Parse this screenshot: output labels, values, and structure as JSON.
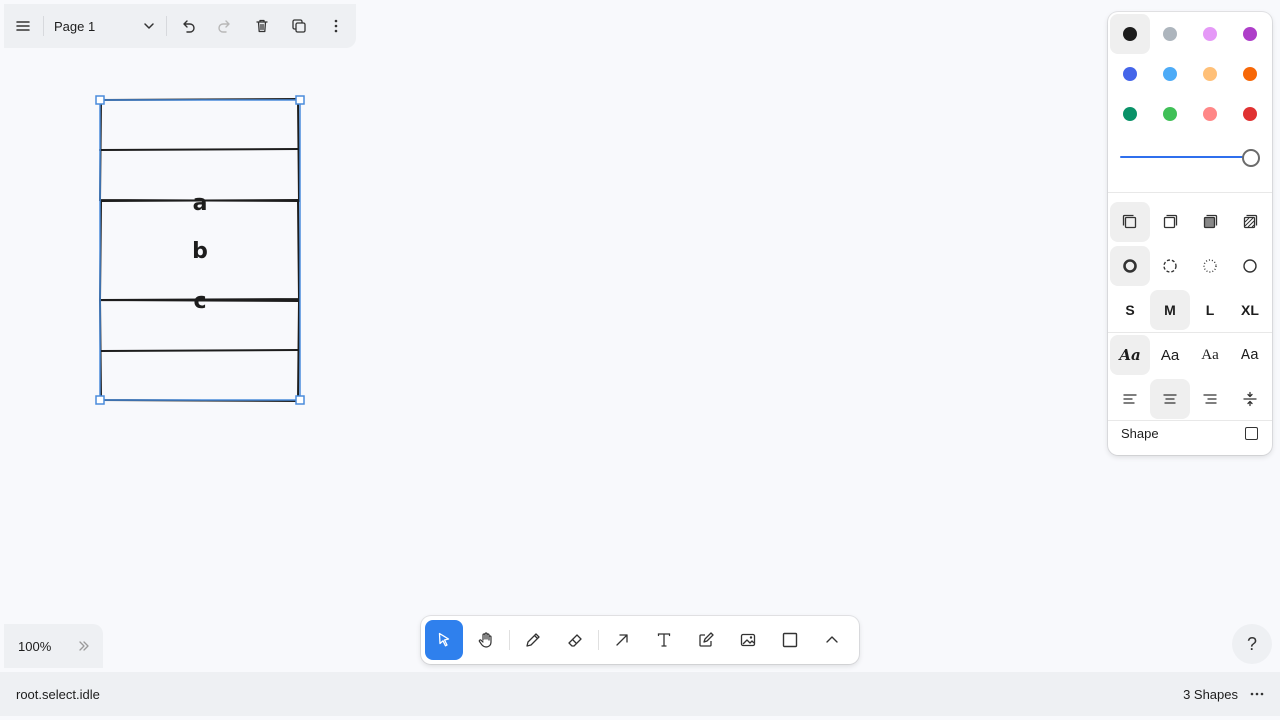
{
  "menubar": {
    "page_name": "Page 1"
  },
  "canvas": {
    "labels": [
      "a",
      "b",
      "c"
    ]
  },
  "style_panel": {
    "colors": [
      "#1d1d1d",
      "#adb5bd",
      "#e599f7",
      "#ae3ec9",
      "#4465e9",
      "#4dabf7",
      "#ffc078",
      "#f76707",
      "#099268",
      "#40c057",
      "#ff8787",
      "#e03131"
    ],
    "selected_color_index": 0,
    "opacity": 1.0,
    "sizes": [
      "S",
      "M",
      "L",
      "XL"
    ],
    "selected_size": "M",
    "font_sample": "Aa",
    "shape_label": "Shape"
  },
  "toolbar": {
    "tools": [
      "select-tool",
      "hand-tool",
      "draw-tool",
      "eraser-tool",
      "arrow-tool",
      "text-tool",
      "note-tool",
      "image-tool",
      "rectangle-tool",
      "more-tools"
    ],
    "selected_tool": "select-tool"
  },
  "zoom": {
    "level": "100%"
  },
  "statusbar": {
    "state": "root.select.idle",
    "shape_count": "3 Shapes"
  },
  "help": {
    "label": "?"
  }
}
